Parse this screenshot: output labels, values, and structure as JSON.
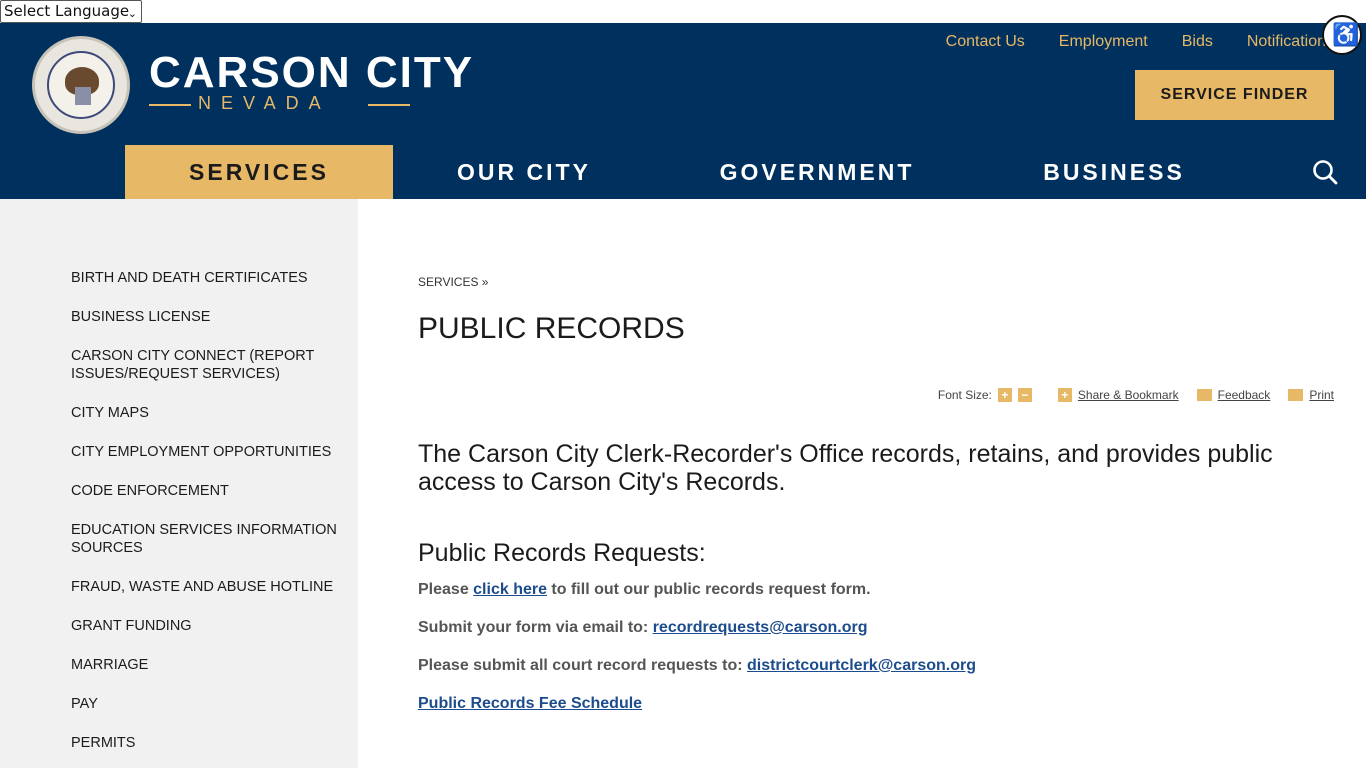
{
  "language": {
    "label": "Select Language"
  },
  "header": {
    "seal_text": "SEAL OF THE STATE OF CARSON CITY NEVADA",
    "brand_title": "CARSON CITY",
    "brand_sub": "NEVADA",
    "util_links": [
      "Contact Us",
      "Employment",
      "Bids",
      "Notifications"
    ],
    "service_finder": "SERVICE FINDER",
    "nav": [
      "SERVICES",
      "OUR CITY",
      "GOVERNMENT",
      "BUSINESS"
    ]
  },
  "sidebar": {
    "items": [
      "BIRTH AND DEATH CERTIFICATES",
      "BUSINESS LICENSE",
      "CARSON CITY CONNECT (REPORT ISSUES/REQUEST SERVICES)",
      "CITY MAPS",
      "CITY EMPLOYMENT OPPORTUNITIES",
      "CODE ENFORCEMENT",
      "EDUCATION SERVICES INFORMATION SOURCES",
      "FRAUD, WASTE AND ABUSE HOTLINE",
      "GRANT FUNDING",
      "MARRIAGE",
      "PAY",
      "PERMITS"
    ]
  },
  "content": {
    "breadcrumb": "SERVICES »",
    "title": "PUBLIC RECORDS",
    "tools": {
      "font_size": "Font Size:",
      "plus": "+",
      "minus": "−",
      "share": "Share & Bookmark",
      "feedback": "Feedback",
      "print": "Print"
    },
    "intro": "The Carson City Clerk-Recorder's Office records, retains, and provides public access to Carson City's Records.",
    "requests_heading": "Public Records Requests:",
    "line1_pre": "Please ",
    "line1_link": "click here",
    "line1_post": " to fill out our public records request form.",
    "line2_pre": "Submit your form via email to: ",
    "line2_link": "recordrequests@carson.org",
    "line3_pre": "Please submit all court record requests to: ",
    "line3_link": "districtcourtclerk@carson.org",
    "fee_link": "Public Records Fee Schedule"
  }
}
